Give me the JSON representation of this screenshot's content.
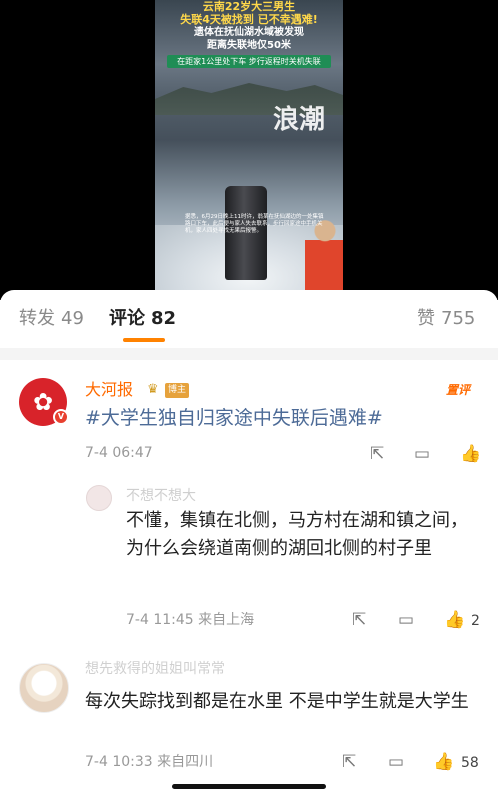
{
  "video": {
    "headline_line1": "云南22岁大三男生",
    "headline_line2": "失联4天被找到 已不幸遇难!",
    "headline_line3": "遗体在抚仙湖水域被发现",
    "headline_line4": "距离失联地仅50米",
    "banner": "在距家1公里处下车 步行返程时关机失联",
    "watermark": "浪潮",
    "caption": "据悉，6月29日晚上11时许，翁某在抚仙湖边的一处集镇路口下车，此后便与家人失去联系，步行回家途中手机关机，家人四处寻找无果后报警。"
  },
  "tabs": {
    "repost_label": "转发",
    "repost_count": "49",
    "comment_label": "评论",
    "comment_count": "82",
    "like_label": "赞",
    "like_count": "755"
  },
  "main_comment": {
    "author": "大河报",
    "crown_icon": "crown-icon",
    "owner_tag": "博主",
    "top_tag": "置评",
    "text": "#大学生独自归家途中失联后遇难#",
    "time": "7-4 06:47"
  },
  "reply1": {
    "name": "不想不想大",
    "text": "不懂，集镇在北侧，马方村在湖和镇之间，为什么会绕道南侧的湖回北侧的村子里",
    "time": "7-4 11:45 来自上海",
    "likes": "2"
  },
  "reply2": {
    "name": "想先救得的姐姐叫常常",
    "text": "每次失踪找到都是在水里 不是中学生就是大学生",
    "time": "7-4 10:33 来自四川",
    "likes": "58"
  },
  "colors": {
    "accent": "#ff8200",
    "author": "#ff6a00",
    "topic_link": "#4d6b97",
    "banner_green": "#1f8d55"
  }
}
